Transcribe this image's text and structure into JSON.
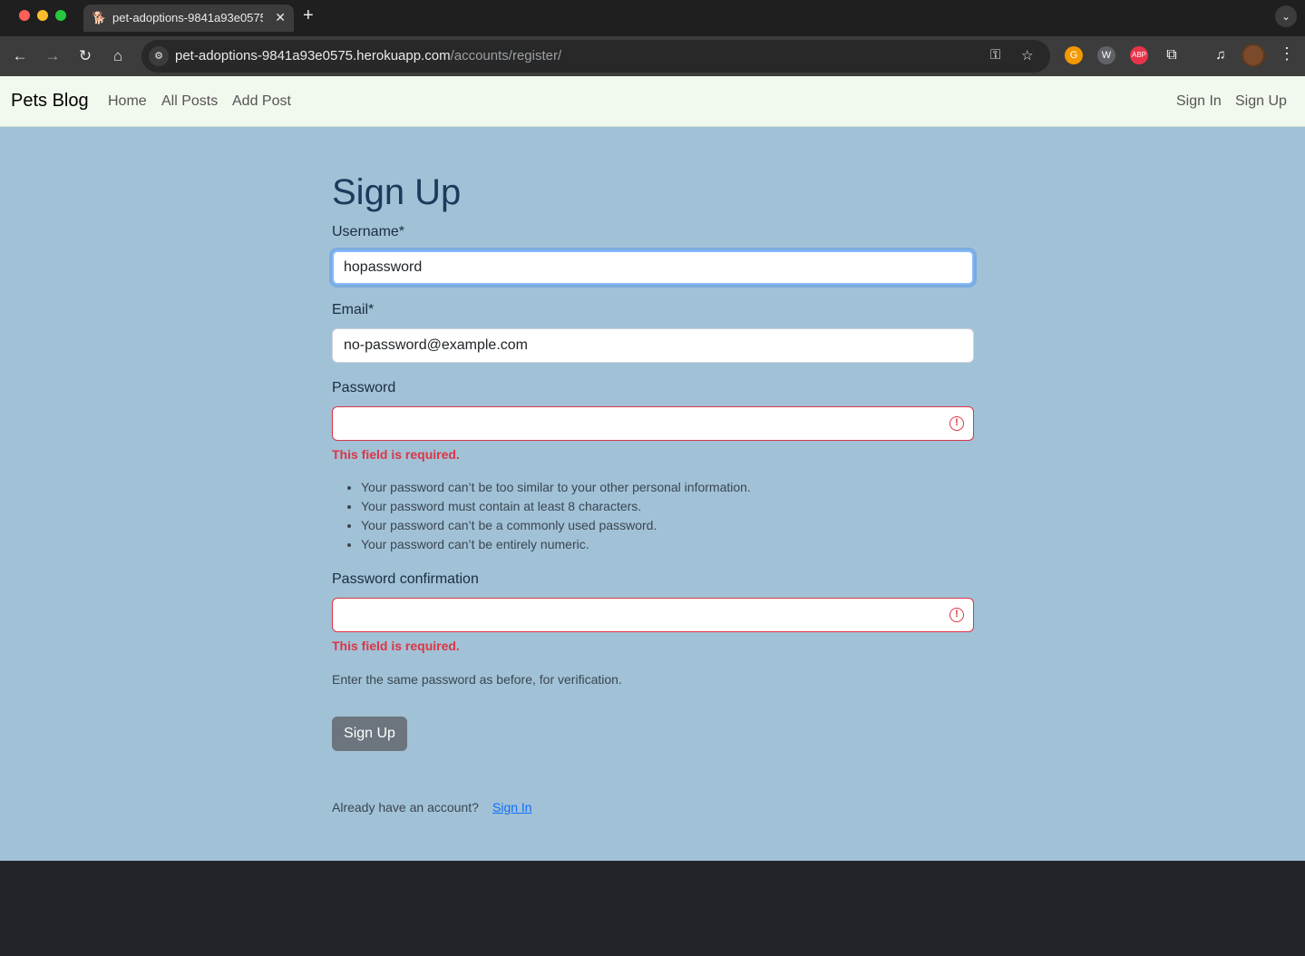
{
  "browser": {
    "tab_title": "pet-adoptions-9841a93e0575.herokuapp.com",
    "url_host": "pet-adoptions-9841a93e0575.herokuapp.com",
    "url_path": "/accounts/register/"
  },
  "navbar": {
    "brand": "Pets Blog",
    "links": [
      "Home",
      "All Posts",
      "Add Post"
    ],
    "auth_links": [
      "Sign In",
      "Sign Up"
    ]
  },
  "form": {
    "title": "Sign Up",
    "username_label": "Username*",
    "username_value": "hopassword",
    "email_label": "Email*",
    "email_value": "no-password@example.com",
    "password_label": "Password",
    "password_error": "This field is required.",
    "password_help": [
      "Your password can’t be too similar to your other personal information.",
      "Your password must contain at least 8 characters.",
      "Your password can’t be a commonly used password.",
      "Your password can’t be entirely numeric."
    ],
    "confirm_label": "Password confirmation",
    "confirm_error": "This field is required.",
    "confirm_help": "Enter the same password as before, for verification.",
    "submit_label": "Sign Up",
    "already_text": "Already have an account?",
    "signin_link": "Sign In"
  },
  "colors": {
    "page_bg": "#a1c1d6",
    "navbar_bg": "#f1f8ed",
    "error": "#dc3545",
    "button": "#6c757d",
    "footer": "#212529"
  }
}
